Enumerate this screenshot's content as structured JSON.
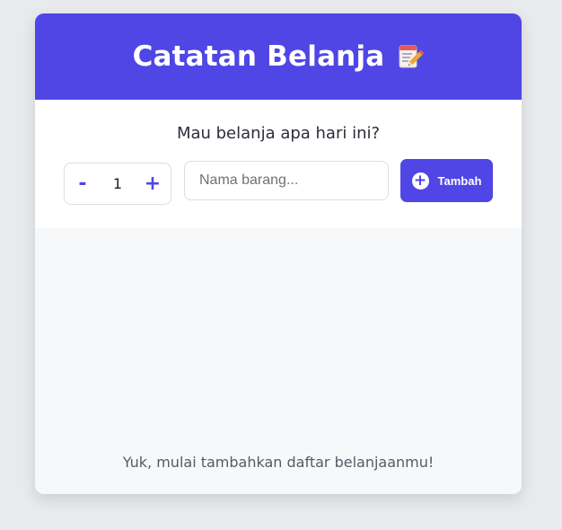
{
  "header": {
    "title": "Catatan Belanja",
    "title_icon": "memo-pencil-icon"
  },
  "form": {
    "question": "Mau belanja apa hari ini?",
    "stepper": {
      "decrement_label": "-",
      "quantity": "1",
      "increment_label": "+"
    },
    "item_input": {
      "value": "",
      "placeholder": "Nama barang..."
    },
    "add_button": {
      "icon": "plus-circle-icon",
      "label": "Tambah"
    }
  },
  "list": {
    "empty_message": "Yuk, mulai tambahkan daftar belanjaanmu!"
  },
  "colors": {
    "accent": "#4f46e5",
    "background": "#e8eaed",
    "card": "#f7f8fa"
  }
}
